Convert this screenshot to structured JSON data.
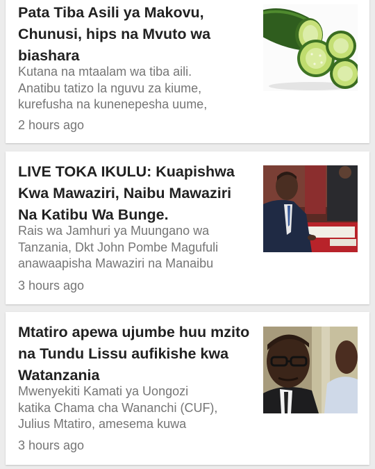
{
  "articles": [
    {
      "headline": "Pata Tiba Asili ya Makovu, Chunusi, hips na Mvuto wa biashara",
      "snippet": "Kutana na mtaalam wa tiba aili.\nAnatibu tatizo la  nguvu za kiume,\nkurefusha na kunenepesha uume,",
      "time": "2 hours ago",
      "thumbnail_icon": "cucumber-slices-image"
    },
    {
      "headline": "LIVE TOKA IKULU: Kuapishwa Kwa Mawaziri, Naibu Mawaziri Na Katibu Wa Bunge.",
      "snippet": "Rais wa Jamhuri ya Muungano wa\nTanzania, Dkt John Pombe Magufuli\nanawaapisha Mawaziri na Manaibu",
      "time": "3 hours ago",
      "thumbnail_icon": "swearing-in-ceremony-image"
    },
    {
      "headline": "Mtatiro apewa ujumbe huu mzito na Tundu Lissu aufikishe kwa Watanzania",
      "snippet": "Mwenyekiti Kamati ya Uongozi\nkatika Chama cha Wananchi (CUF),\nJulius Mtatiro, amesema kuwa",
      "time": "3 hours ago",
      "thumbnail_icon": "politicians-portrait-image"
    }
  ]
}
